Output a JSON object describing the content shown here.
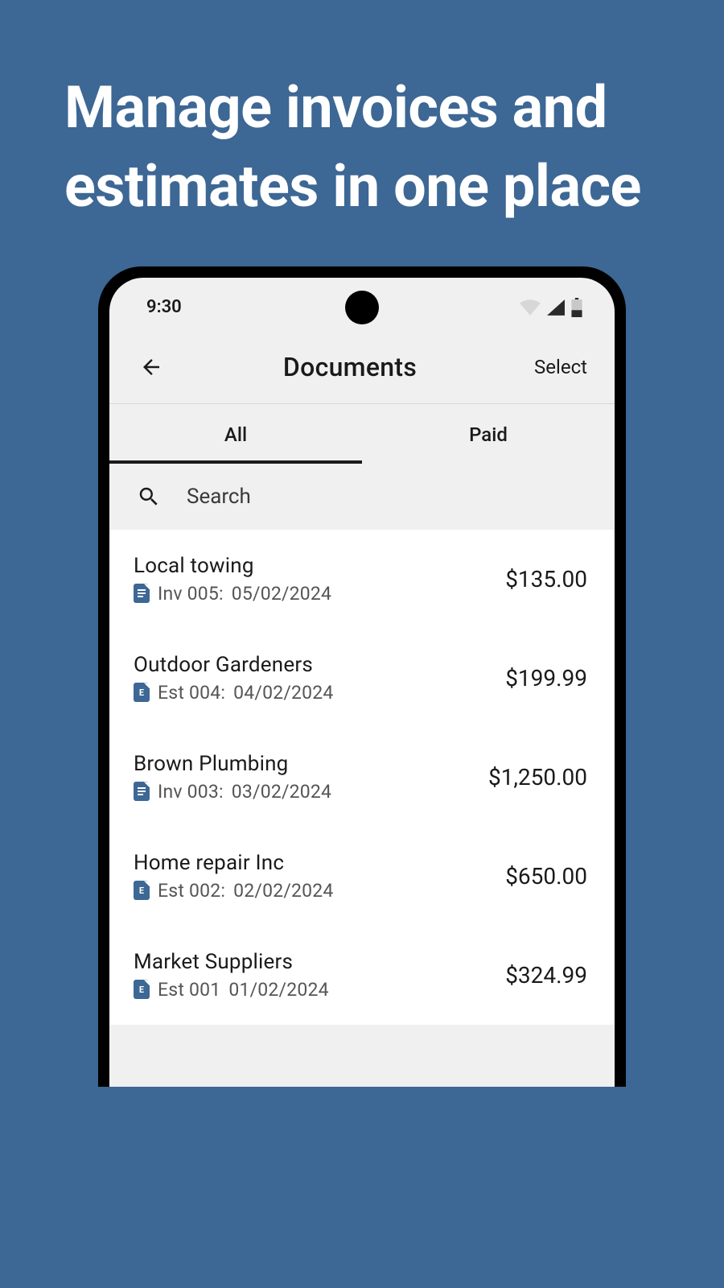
{
  "hero": {
    "title": "Manage invoices and estimates in one place"
  },
  "status": {
    "time": "9:30"
  },
  "header": {
    "title": "Documents",
    "select": "Select"
  },
  "tabs": {
    "all": "All",
    "paid": "Paid"
  },
  "search": {
    "placeholder": "Search"
  },
  "documents": [
    {
      "title": "Local towing",
      "type": "inv",
      "code": "Inv 005:",
      "date": "05/02/2024",
      "amount": "$135.00"
    },
    {
      "title": "Outdoor Gardeners",
      "type": "est",
      "code": "Est 004:",
      "date": "04/02/2024",
      "amount": "$199.99"
    },
    {
      "title": "Brown Plumbing",
      "type": "inv",
      "code": "Inv 003:",
      "date": "03/02/2024",
      "amount": "$1,250.00"
    },
    {
      "title": "Home repair Inc",
      "type": "est",
      "code": "Est 002:",
      "date": "02/02/2024",
      "amount": "$650.00"
    },
    {
      "title": "Market Suppliers",
      "type": "est",
      "code": "Est 001",
      "date": "01/02/2024",
      "amount": "$324.99"
    }
  ]
}
